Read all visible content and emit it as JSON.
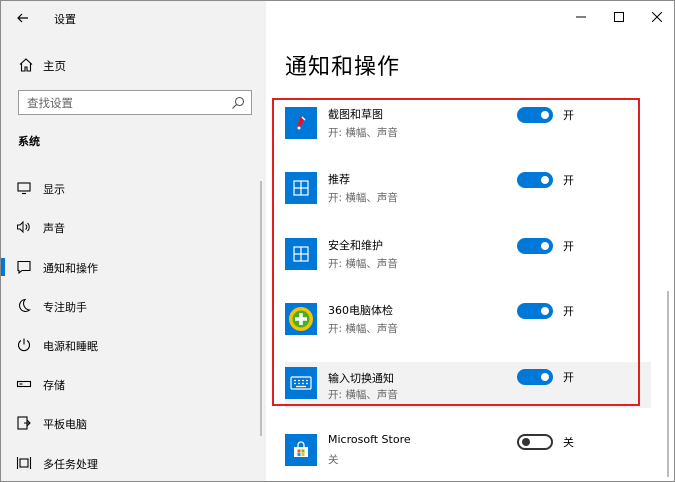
{
  "window": {
    "title": "设置"
  },
  "sidebar": {
    "home_label": "主页",
    "search": {
      "placeholder": "查找设置",
      "value": ""
    },
    "section_title": "系统",
    "items": [
      {
        "label": "显示",
        "icon": "display-icon"
      },
      {
        "label": "声音",
        "icon": "sound-icon"
      },
      {
        "label": "通知和操作",
        "icon": "notification-icon",
        "active": true
      },
      {
        "label": "专注助手",
        "icon": "moon-icon"
      },
      {
        "label": "电源和睡眠",
        "icon": "power-icon"
      },
      {
        "label": "存储",
        "icon": "storage-icon"
      },
      {
        "label": "平板电脑",
        "icon": "tablet-icon"
      },
      {
        "label": "多任务处理",
        "icon": "multitask-icon"
      }
    ]
  },
  "main": {
    "title": "通知和操作",
    "apps": [
      {
        "name": "截图和草图",
        "sub": "开: 横幅、声音",
        "toggle": "开",
        "on": true,
        "icon": "snip-sketch-icon"
      },
      {
        "name": "推荐",
        "sub": "开: 横幅、声音",
        "toggle": "开",
        "on": true,
        "icon": "windows-app-icon"
      },
      {
        "name": "安全和维护",
        "sub": "开: 横幅、声音",
        "toggle": "开",
        "on": true,
        "icon": "windows-app-icon"
      },
      {
        "name": "360电脑体检",
        "sub": "开: 横幅、声音",
        "toggle": "开",
        "on": true,
        "icon": "360-checkup-icon"
      },
      {
        "name": "输入切换通知",
        "sub": "开: 横幅、声音",
        "toggle": "开",
        "on": true,
        "icon": "keyboard-icon"
      },
      {
        "name": "Microsoft Store",
        "sub": "关",
        "toggle": "关",
        "on": false,
        "icon": "store-icon"
      }
    ]
  },
  "colors": {
    "accent": "#0078d7",
    "highlight": "#e02020",
    "sidebar_bg": "#f2f2f2"
  }
}
